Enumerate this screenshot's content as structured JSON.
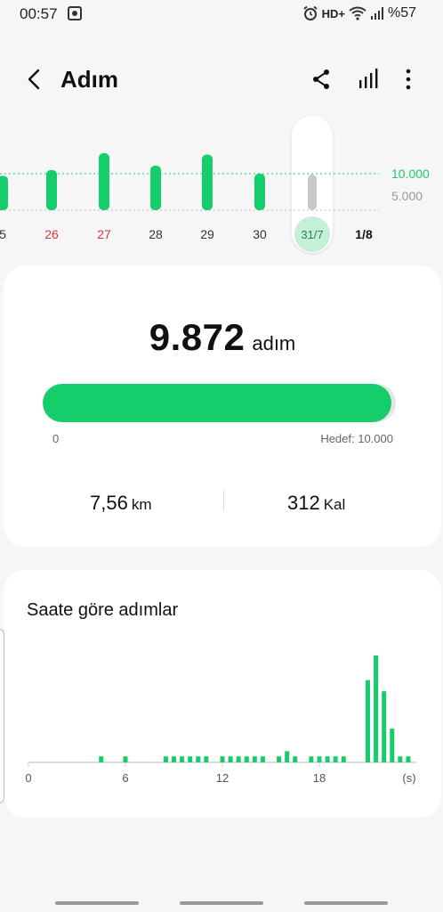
{
  "status_bar": {
    "time": "00:57",
    "network": "HD+",
    "battery": "%57"
  },
  "header": {
    "title": "Adım"
  },
  "weekly_chart": {
    "days": [
      "5",
      "26",
      "27",
      "28",
      "29",
      "30",
      "31/7",
      "1/8"
    ],
    "day_colors": [
      "#333333",
      "#d23b3b",
      "#d23b3b",
      "#333333",
      "#333333",
      "#333333",
      "#1d8a4a",
      "#111111"
    ],
    "steps": [
      9700,
      10500,
      12800,
      11100,
      12600,
      10000,
      9872,
      0
    ],
    "goal_label": "10.000",
    "mid_label": "5.000",
    "goal_color": "#16cd6c",
    "selected_day": "31/7"
  },
  "today": {
    "steps": "9.872",
    "steps_unit": "adım",
    "progress": 0.9872,
    "progress_start": "0",
    "goal_text": "Hedef: 10.000",
    "distance_value": "7,56",
    "distance_unit": "km",
    "calories_value": "312",
    "calories_unit": "Kal"
  },
  "hourly": {
    "title": "Saate göre adımlar",
    "ticks": [
      "0",
      "6",
      "12",
      "18",
      "(s)"
    ]
  },
  "chart_data": {
    "type": "bar",
    "title": "Saate göre adımlar",
    "xlabel": "(s)",
    "ylabel": "",
    "x_ticks": [
      "0",
      "6",
      "12",
      "18"
    ],
    "x": [
      4.5,
      6,
      8.5,
      9,
      9.5,
      10,
      10.5,
      11,
      12,
      12.5,
      13,
      13.5,
      14,
      14.5,
      15.5,
      16,
      16.5,
      17.5,
      18,
      18.5,
      19,
      19.5,
      21,
      21.5,
      22,
      22.5,
      23,
      23.5
    ],
    "values": [
      8,
      8,
      8,
      8,
      8,
      8,
      8,
      8,
      8,
      8,
      8,
      8,
      8,
      8,
      8,
      15,
      8,
      8,
      8,
      8,
      8,
      8,
      110,
      143,
      95,
      45,
      8,
      8
    ],
    "xlim": [
      0,
      24
    ],
    "ylim": [
      0,
      150
    ],
    "bar_color": "#16cd6c"
  }
}
